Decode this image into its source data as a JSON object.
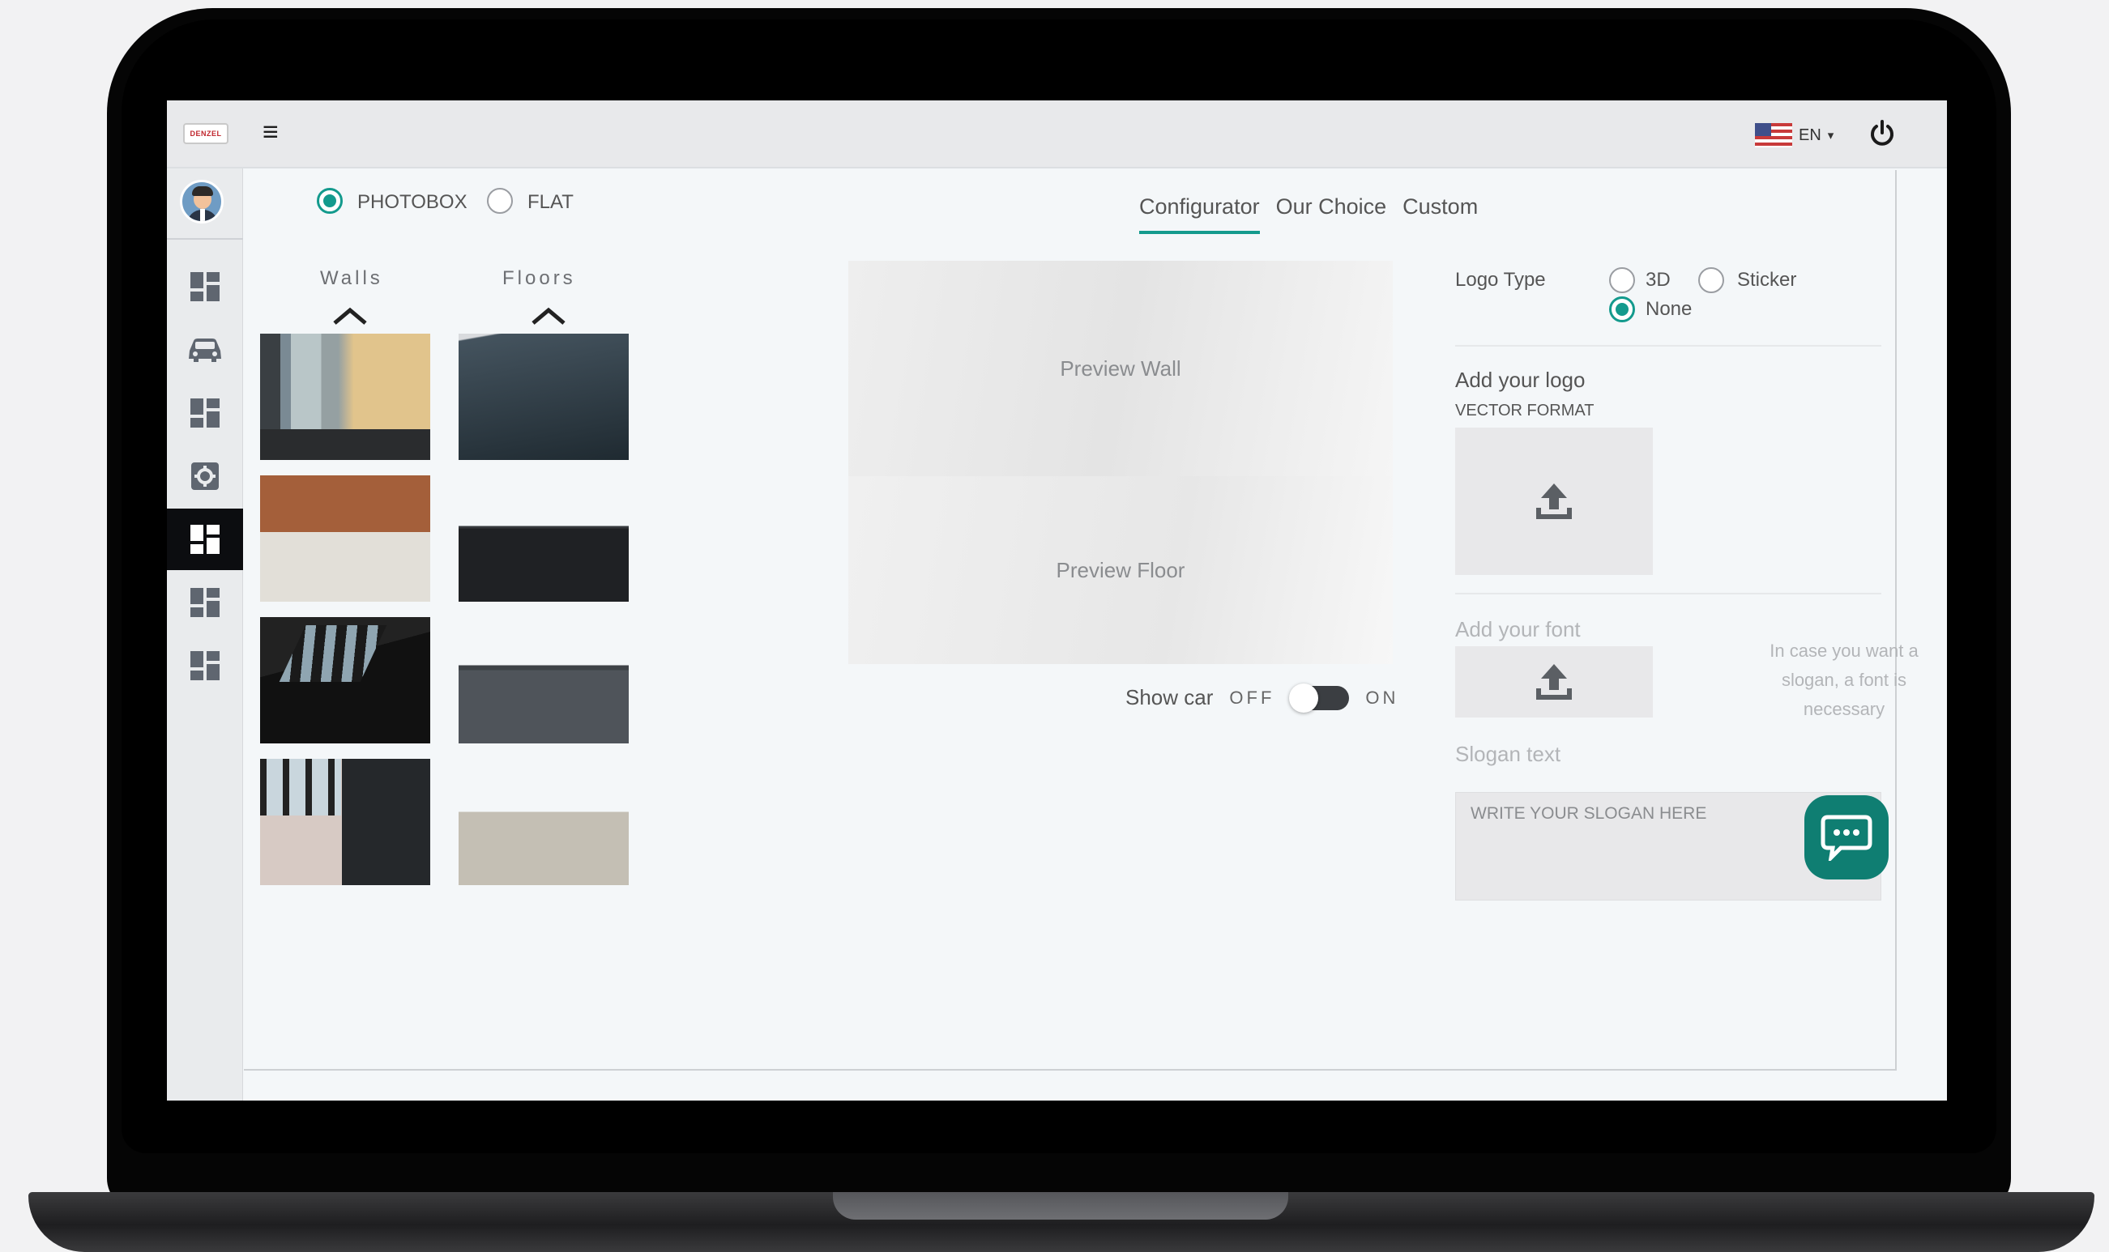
{
  "topbar": {
    "menu_icon": "hamburger-icon",
    "logo_text": "DENZEL",
    "language": "EN",
    "flag_icon": "us-flag-icon",
    "power_icon": "power-icon"
  },
  "sidebar": {
    "items": [
      {
        "icon": "dashboard-icon",
        "active": false
      },
      {
        "icon": "car-icon",
        "active": false
      },
      {
        "icon": "dashboard-icon",
        "active": false
      },
      {
        "icon": "settings-icon",
        "active": false
      },
      {
        "icon": "dashboard-icon",
        "active": true
      },
      {
        "icon": "dashboard-icon",
        "active": false
      },
      {
        "icon": "dashboard-icon",
        "active": false
      }
    ]
  },
  "mode": {
    "photobox": "PHOTOBOX",
    "flat": "FLAT",
    "selected": "PHOTOBOX"
  },
  "library": {
    "walls_title": "Walls",
    "floors_title": "Floors"
  },
  "tabs": [
    {
      "label": "Configurator",
      "active": true
    },
    {
      "label": "Our Choice",
      "active": false
    },
    {
      "label": "Custom",
      "active": false
    }
  ],
  "preview": {
    "wall": "Preview Wall",
    "floor": "Preview Floor"
  },
  "show_car": {
    "label": "Show car",
    "off": "OFF",
    "on": "ON",
    "value": "OFF"
  },
  "logo": {
    "type_label": "Logo Type",
    "options": {
      "a": "3D",
      "b": "Sticker",
      "c": "None"
    },
    "selected": "None",
    "add_title": "Add your logo",
    "format": "VECTOR FORMAT"
  },
  "font": {
    "title": "Add your font",
    "hint": "In case you want a slogan, a font is necessary"
  },
  "slogan": {
    "label": "Slogan text",
    "placeholder": "WRITE YOUR SLOGAN HERE"
  },
  "colors": {
    "accent": "#139a8d",
    "chat": "#0f7e72"
  }
}
